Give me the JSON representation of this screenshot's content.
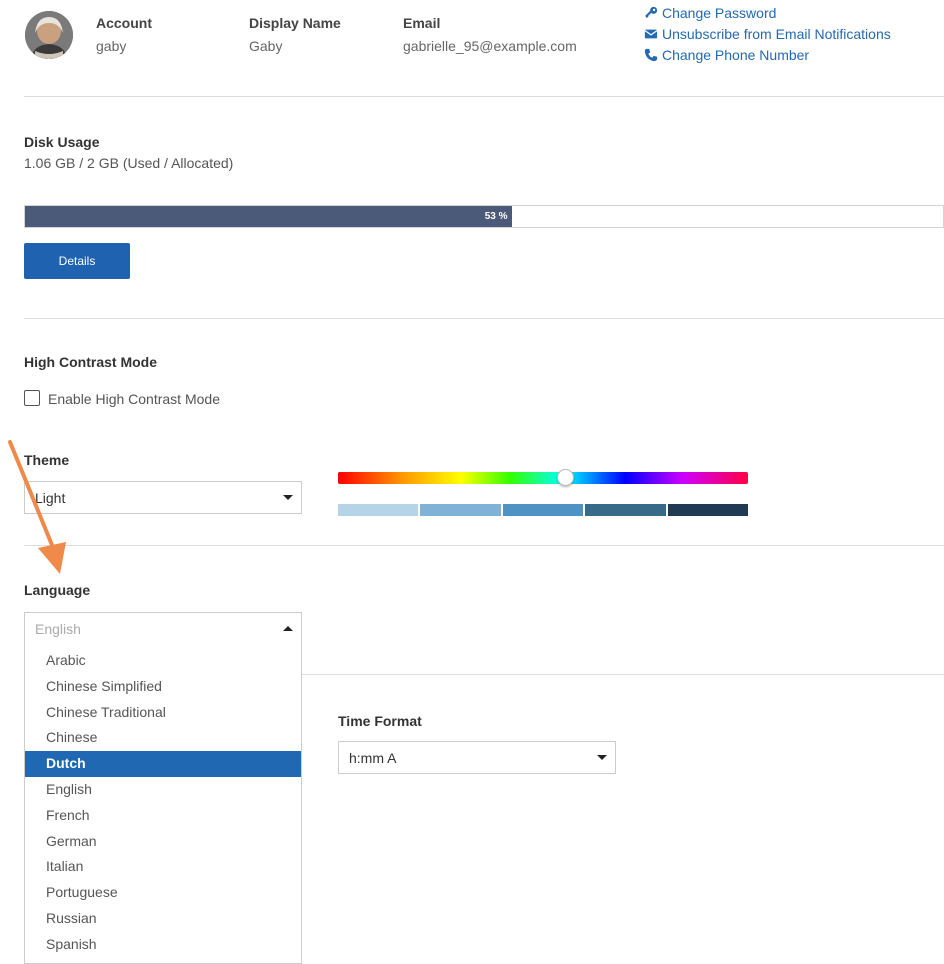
{
  "header": {
    "account_label": "Account",
    "account_value": "gaby",
    "display_name_label": "Display Name",
    "display_name_value": "Gaby",
    "email_label": "Email",
    "email_value": "gabrielle_95@example.com",
    "links": {
      "change_password": "Change Password",
      "unsubscribe": "Unsubscribe from Email Notifications",
      "change_phone": "Change Phone Number"
    }
  },
  "disk": {
    "title": "Disk Usage",
    "summary": "1.06 GB / 2 GB (Used / Allocated)",
    "progress_percent": 53,
    "progress_label": "53 %",
    "details_button": "Details"
  },
  "high_contrast": {
    "title": "High Contrast Mode",
    "checkbox_label": "Enable High Contrast Mode",
    "checked": false
  },
  "theme": {
    "title": "Theme",
    "selected": "Light",
    "swatch_colors": [
      "#b6d4e8",
      "#7fb2d6",
      "#4e93c3",
      "#376a89",
      "#1f3a52"
    ]
  },
  "language": {
    "title": "Language",
    "placeholder": "English",
    "options": [
      "Arabic",
      "Chinese Simplified",
      "Chinese Traditional",
      "Chinese",
      "Dutch",
      "English",
      "French",
      "German",
      "Italian",
      "Portuguese",
      "Russian",
      "Spanish"
    ],
    "highlighted": "Dutch"
  },
  "time_format": {
    "title": "Time Format",
    "selected": "h:mm A"
  },
  "colors": {
    "accent": "#1f63b0",
    "progress_fill": "#4a5a78",
    "annotation_arrow": "#f08a4b"
  }
}
